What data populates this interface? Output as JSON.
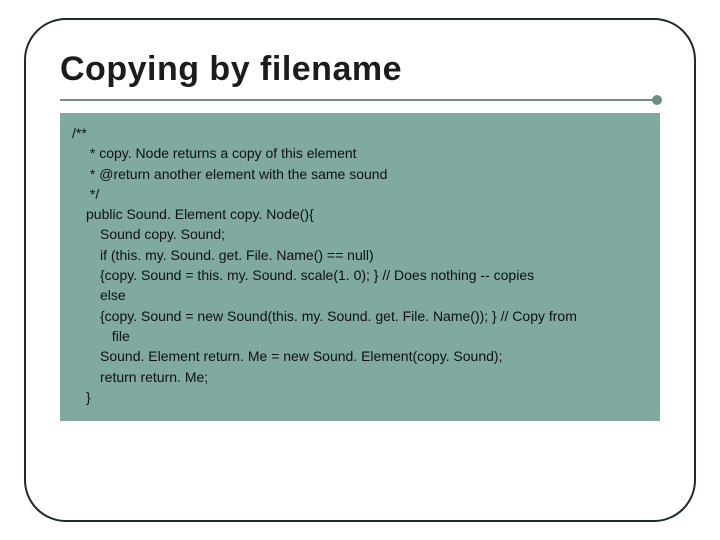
{
  "title": "Copying by filename",
  "code": {
    "l0": "/**",
    "l1": " * copy. Node returns a copy of this element",
    "l2": " * @return another element with the same sound",
    "l3": " */",
    "l4": "public Sound. Element copy. Node(){",
    "l5": "Sound copy. Sound;",
    "l6": "if (this. my. Sound. get. File. Name() == null)",
    "l7": "{copy. Sound = this. my. Sound. scale(1. 0); } // Does nothing -- copies",
    "l8": "else",
    "l9": "{copy. Sound = new Sound(this. my. Sound. get. File. Name()); } // Copy from",
    "l10": " file",
    "l11": "Sound. Element return. Me = new Sound. Element(copy. Sound);",
    "l12": "return return. Me;",
    "l13": "}"
  }
}
